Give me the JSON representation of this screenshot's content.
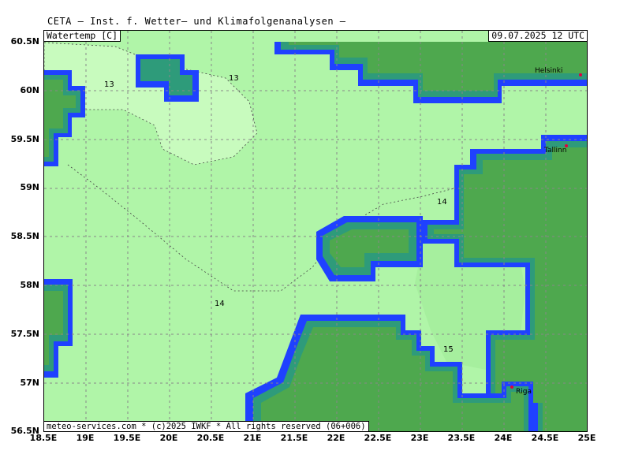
{
  "header": {
    "title": "CETA — Inst. f. Wetter— und Klimafolgenanalysen —"
  },
  "map": {
    "parameter_label": "Watertemp [C]",
    "datetime_label": "09.07.2025 12 UTC",
    "footer": "meteo-services.com * (c)2025 IWKF * All rights reserved (06+006)",
    "lat_labels": [
      "60.5N",
      "60N",
      "59.5N",
      "59N",
      "58.5N",
      "58N",
      "57.5N",
      "57N",
      "56.5N"
    ],
    "lon_labels": [
      "18.5E",
      "19E",
      "19.5E",
      "20E",
      "20.5E",
      "21E",
      "21.5E",
      "22E",
      "22.5E",
      "23E",
      "23.5E",
      "24E",
      "24.5E",
      "25E"
    ],
    "contour_labels": [
      "13",
      "13",
      "14",
      "14",
      "15"
    ],
    "cities": [
      "Helsinki",
      "Tallinn",
      "Riga"
    ],
    "colors": {
      "water_13": "#c8fbbe",
      "water_14": "#b0f5a8",
      "water_15": "#a6ef9e",
      "land": "#4ea84e",
      "coast_edge": "#1f41ff",
      "coast_mid": "#2e9b7a"
    }
  }
}
